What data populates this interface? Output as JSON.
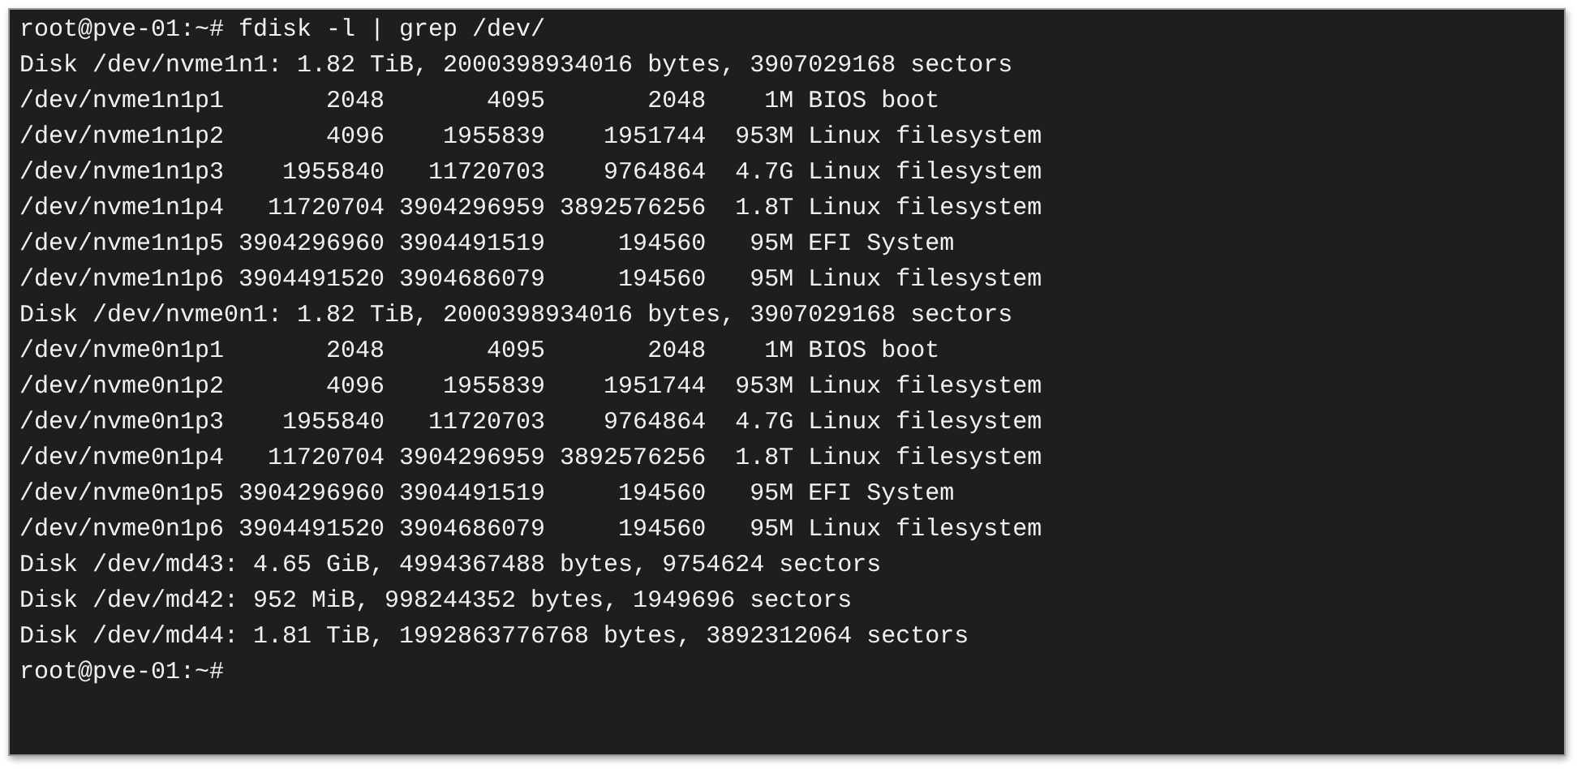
{
  "terminal": {
    "lines": [
      "root@pve-01:~# fdisk -l | grep /dev/",
      "Disk /dev/nvme1n1: 1.82 TiB, 2000398934016 bytes, 3907029168 sectors",
      "/dev/nvme1n1p1       2048       4095       2048    1M BIOS boot",
      "/dev/nvme1n1p2       4096    1955839    1951744  953M Linux filesystem",
      "/dev/nvme1n1p3    1955840   11720703    9764864  4.7G Linux filesystem",
      "/dev/nvme1n1p4   11720704 3904296959 3892576256  1.8T Linux filesystem",
      "/dev/nvme1n1p5 3904296960 3904491519     194560   95M EFI System",
      "/dev/nvme1n1p6 3904491520 3904686079     194560   95M Linux filesystem",
      "Disk /dev/nvme0n1: 1.82 TiB, 2000398934016 bytes, 3907029168 sectors",
      "/dev/nvme0n1p1       2048       4095       2048    1M BIOS boot",
      "/dev/nvme0n1p2       4096    1955839    1951744  953M Linux filesystem",
      "/dev/nvme0n1p3    1955840   11720703    9764864  4.7G Linux filesystem",
      "/dev/nvme0n1p4   11720704 3904296959 3892576256  1.8T Linux filesystem",
      "/dev/nvme0n1p5 3904296960 3904491519     194560   95M EFI System",
      "/dev/nvme0n1p6 3904491520 3904686079     194560   95M Linux filesystem",
      "Disk /dev/md43: 4.65 GiB, 4994367488 bytes, 9754624 sectors",
      "Disk /dev/md42: 952 MiB, 998244352 bytes, 1949696 sectors",
      "Disk /dev/md44: 1.81 TiB, 1992863776768 bytes, 3892312064 sectors",
      "root@pve-01:~#"
    ]
  }
}
